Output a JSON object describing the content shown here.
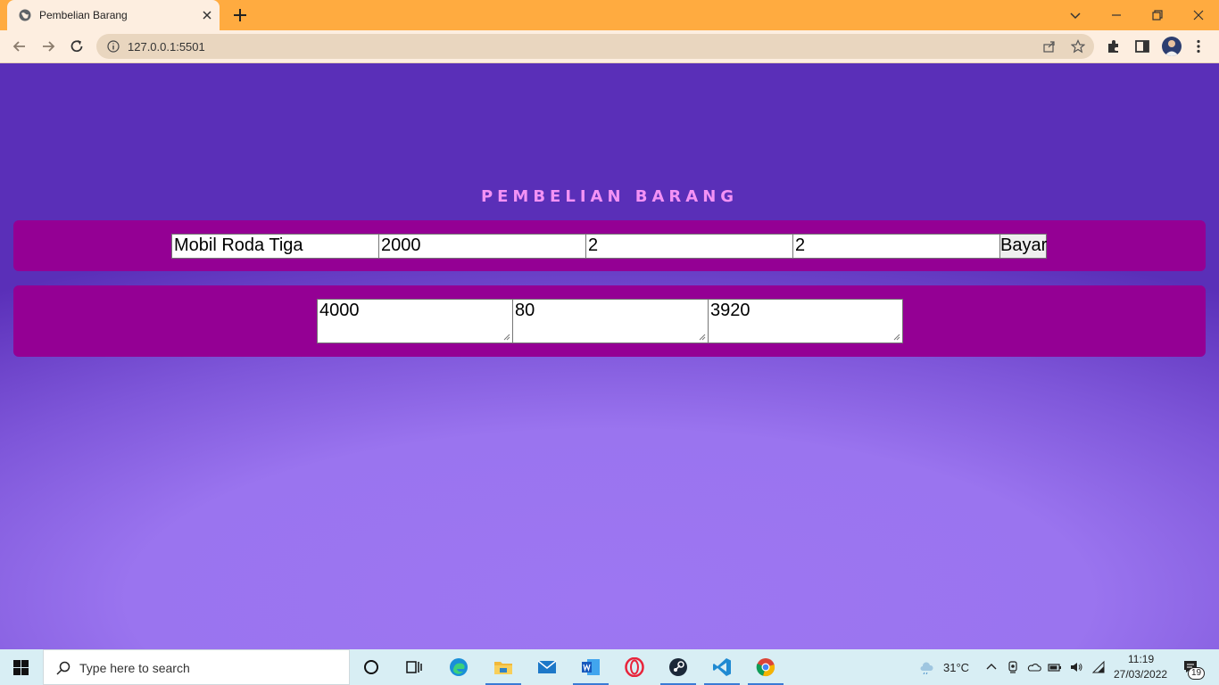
{
  "browser": {
    "tab_title": "Pembelian Barang",
    "url": "127.0.0.1:5501"
  },
  "page": {
    "title": "PEMBELIAN BARANG",
    "inputs": {
      "item_name": "Mobil Roda Tiga",
      "price": "2000",
      "quantity": "2",
      "discount": "2"
    },
    "pay_button_label": "Bayar",
    "outputs": {
      "total": "4000",
      "discount_amount": "80",
      "grand_total": "3920"
    }
  },
  "taskbar": {
    "search_placeholder": "Type here to search",
    "temperature": "31°C",
    "time": "11:19",
    "date": "27/03/2022",
    "notification_count": "19",
    "apps": [
      "cortana-icon",
      "task-view-icon",
      "edge-icon",
      "file-explorer-icon",
      "mail-icon",
      "word-icon",
      "opera-icon",
      "steam-icon",
      "vscode-icon",
      "chrome-icon"
    ]
  },
  "colors": {
    "titlebar": "#ffab40",
    "panel": "#940094",
    "title_text": "#f392f5",
    "background": "#9b75f0"
  }
}
